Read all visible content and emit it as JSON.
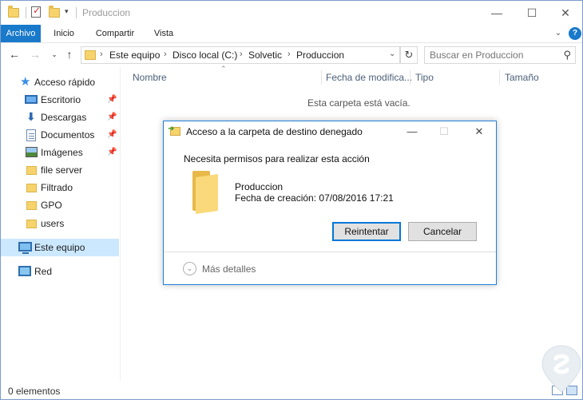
{
  "window": {
    "title": "Produccion",
    "controls": {
      "minimize": "—",
      "maximize": "☐",
      "close": "✕"
    }
  },
  "ribbon": {
    "tabs": [
      "Archivo",
      "Inicio",
      "Compartir",
      "Vista"
    ],
    "expand_icon": "chevron-down-icon",
    "help_icon": "help-icon",
    "help_glyph": "?"
  },
  "navigation": {
    "breadcrumb": [
      "Este equipo",
      "Disco local (C:)",
      "Solvetic",
      "Produccion"
    ],
    "search_placeholder": "Buscar en Produccion"
  },
  "sidebar": {
    "items": [
      {
        "label": "Acceso rápido",
        "icon": "star-icon",
        "pinned": false
      },
      {
        "label": "Escritorio",
        "icon": "desktop-icon",
        "pinned": true
      },
      {
        "label": "Descargas",
        "icon": "download-icon",
        "pinned": true
      },
      {
        "label": "Documentos",
        "icon": "documents-icon",
        "pinned": true
      },
      {
        "label": "Imágenes",
        "icon": "pictures-icon",
        "pinned": true
      },
      {
        "label": "file server",
        "icon": "folder-icon",
        "pinned": false
      },
      {
        "label": "Filtrado",
        "icon": "folder-icon",
        "pinned": false
      },
      {
        "label": "GPO",
        "icon": "folder-icon",
        "pinned": false
      },
      {
        "label": "users",
        "icon": "folder-icon",
        "pinned": false
      },
      {
        "label": "Este equipo",
        "icon": "computer-icon",
        "pinned": false,
        "selected": true
      },
      {
        "label": "Red",
        "icon": "network-icon",
        "pinned": false
      }
    ]
  },
  "content": {
    "columns": [
      "Nombre",
      "Fecha de modifica...",
      "Tipo",
      "Tamaño"
    ],
    "empty_message": "Esta carpeta está vacía."
  },
  "status_bar": {
    "item_count": "0 elementos"
  },
  "dialog": {
    "title": "Acceso a la carpeta de destino denegado",
    "message": "Necesita permisos para realizar esta acción",
    "folder_name": "Produccion",
    "creation_date": "Fecha de creación: 07/08/2016 17:21",
    "buttons": {
      "retry": "Reintentar",
      "cancel": "Cancelar"
    },
    "more_details": "Más detalles",
    "accent": "#1f80d8"
  },
  "colors": {
    "ribbon_file_tab": "#1979ca",
    "selected_item": "#cce8ff",
    "folder": "#f6d36b"
  }
}
